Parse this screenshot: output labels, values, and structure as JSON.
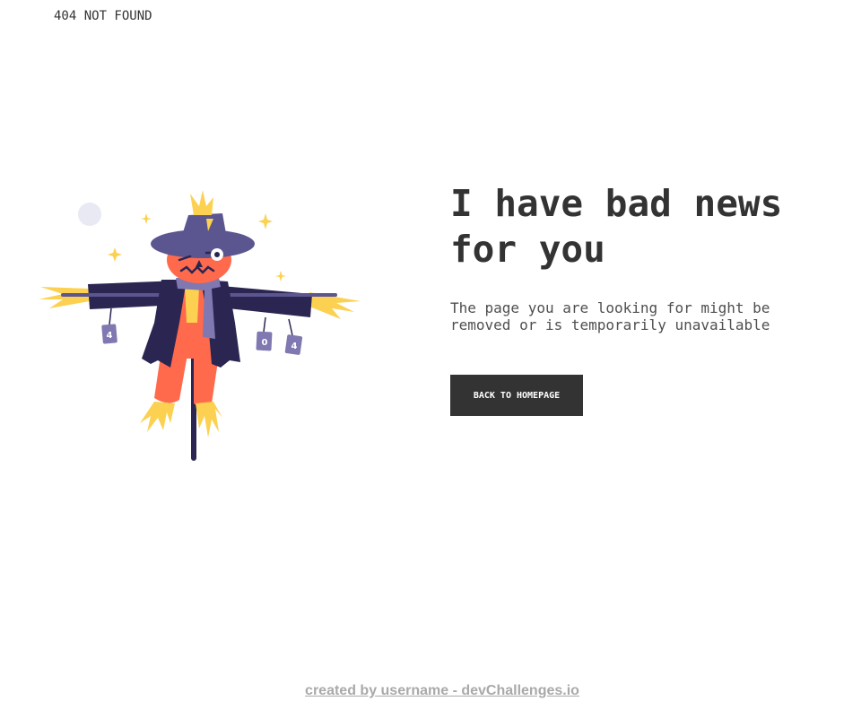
{
  "header": {
    "brand": "404 NOT FOUND"
  },
  "illustration": {
    "name": "scarecrow",
    "cans": [
      "4",
      "0",
      "4"
    ],
    "colors": {
      "coat": "#2b2552",
      "hat": "#5b5590",
      "face": "#ff6a4d",
      "straw": "#fcd151",
      "scarf": "#7f78b1",
      "pole": "#2b2552",
      "moon": "#e8e9f3"
    }
  },
  "main": {
    "headline": "I have bad news for you",
    "message": "The page you are looking for might be removed or is temporarily unavailable",
    "button_label": "BACK TO HOMEPAGE"
  },
  "footer": {
    "prefix": "created by ",
    "username": "username",
    "separator": " - ",
    "site": "devChallenges.io"
  },
  "colors": {
    "text": "#333333",
    "button_bg": "#333333",
    "button_text": "#ffffff",
    "footer_text": "#a9a9a9"
  }
}
